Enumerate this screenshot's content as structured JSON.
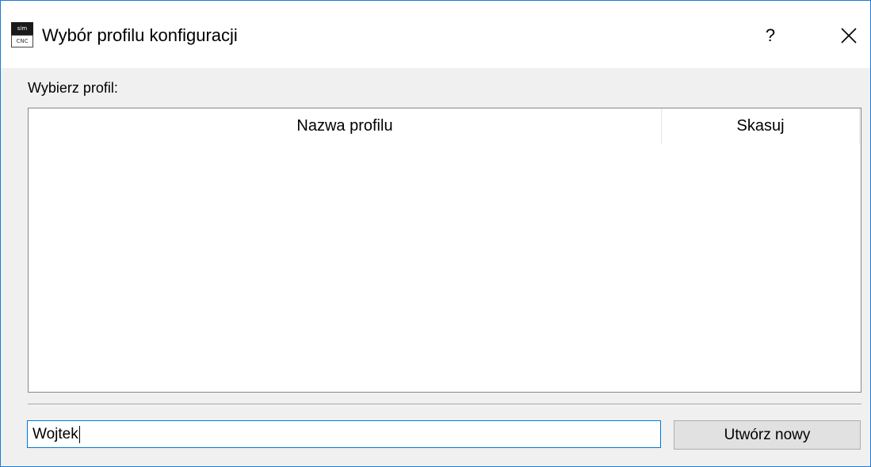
{
  "window": {
    "title": "Wybór profilu konfiguracji",
    "icon": {
      "name": "simcnc-app-icon",
      "top_text": "sim",
      "bottom_text": "CNC"
    },
    "help_label": "?",
    "close_icon": "close-icon",
    "accent_color": "#0078d7"
  },
  "main": {
    "choose_label": "Wybierz profil:",
    "table": {
      "columns": [
        "Nazwa profilu",
        "Skasuj"
      ],
      "rows": []
    }
  },
  "footer": {
    "profile_name_value": "Wojtek",
    "create_button_label": "Utwórz nowy"
  }
}
